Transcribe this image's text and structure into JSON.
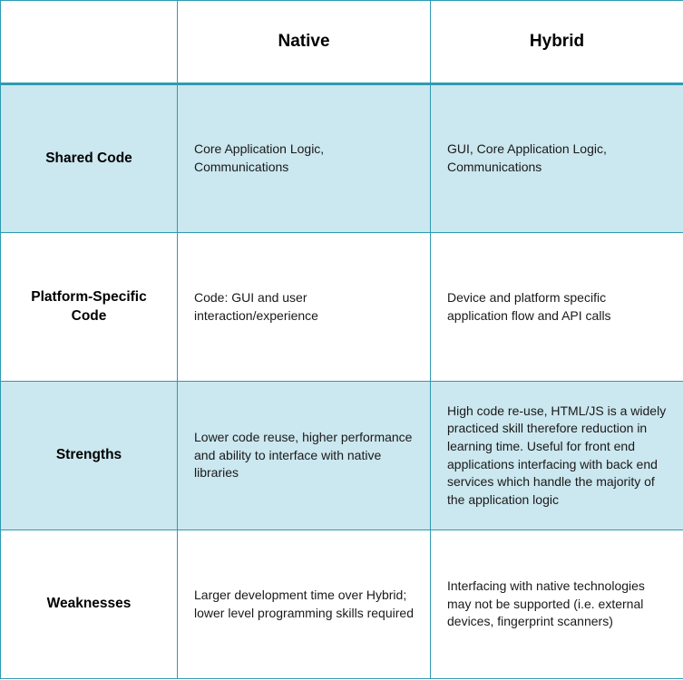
{
  "columns": {
    "native": "Native",
    "hybrid": "Hybrid"
  },
  "rows": [
    {
      "label": "Shared Code",
      "native": "Core Application Logic, Communications",
      "hybrid": "GUI, Core Application Logic, Communications"
    },
    {
      "label": "Platform-Specific Code",
      "native": "Code: GUI and user interaction/experience",
      "hybrid": "Device and platform specific application flow and API calls"
    },
    {
      "label": "Strengths",
      "native": "Lower code reuse, higher performance and ability to interface with native libraries",
      "hybrid": "High code re-use, HTML/JS is a widely practiced skill therefore reduction in learning time. Useful for front end applications interfacing with back end services which handle the majority of the application logic"
    },
    {
      "label": "Weaknesses",
      "native": "Larger development time over Hybrid; lower level programming skills required",
      "hybrid": "Interfacing with native technologies may not be supported (i.e. external devices, fingerprint scanners)"
    }
  ],
  "chart_data": {
    "type": "table",
    "title": "",
    "columns": [
      "",
      "Native",
      "Hybrid"
    ],
    "rows": [
      [
        "Shared Code",
        "Core Application Logic, Communications",
        "GUI, Core Application Logic, Communications"
      ],
      [
        "Platform-Specific Code",
        "Code: GUI and user interaction/experience",
        "Device and platform specific application flow and API calls"
      ],
      [
        "Strengths",
        "Lower code reuse, higher performance and ability to interface with native libraries",
        "High code re-use, HTML/JS is a widely practiced skill therefore reduction in learning time. Useful for front end applications interfacing with back end services which handle the majority of the application logic"
      ],
      [
        "Weaknesses",
        "Larger development time over Hybrid; lower level programming skills required",
        "Interfacing with native technologies may not be supported (i.e. external devices, fingerprint scanners)"
      ]
    ]
  }
}
